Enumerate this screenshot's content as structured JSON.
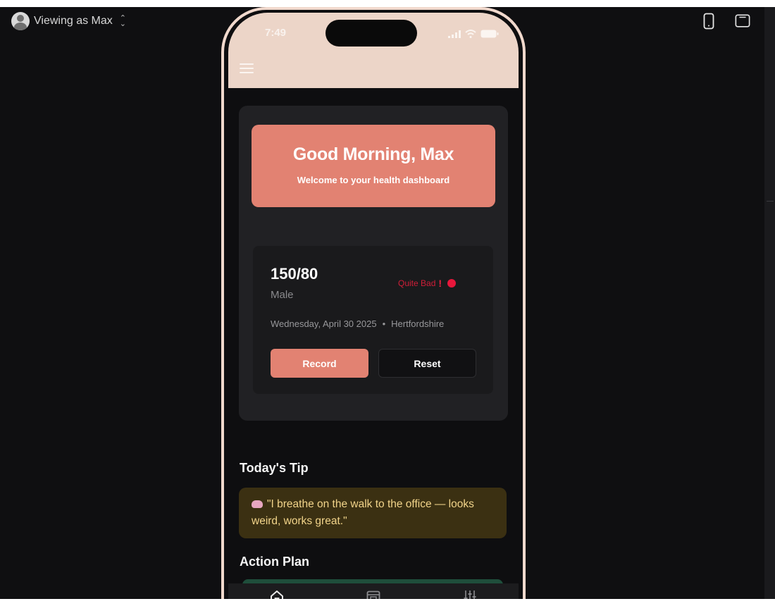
{
  "viewer": {
    "label": "Viewing as Max",
    "avatar_icon": "user-avatar-icon",
    "switch_icon": "chevron-updown-icon"
  },
  "toolbar": {
    "icons": [
      "phone-device-icon",
      "tablet-device-icon"
    ]
  },
  "phone": {
    "status_bar": {
      "time": "7:49",
      "icons": [
        "signal-icon",
        "wifi-icon",
        "battery-icon"
      ]
    },
    "menu_icon": "hamburger-menu-icon",
    "greeting": {
      "title": "Good Morning, Max",
      "subtitle": "Welcome to your health dashboard"
    },
    "reading": {
      "value": "150/80",
      "gender": "Male",
      "status": "Quite Bad",
      "status_mark": "!",
      "date": "Wednesday, April 30 2025",
      "separator": "•",
      "location": "Hertfordshire",
      "record_label": "Record",
      "reset_label": "Reset"
    },
    "tip": {
      "title": "Today's Tip",
      "icon": "brain-icon",
      "text": "\"I breathe on the walk to the office — looks weird, works great.\""
    },
    "action_plan": {
      "title": "Action Plan"
    },
    "bottom_nav": [
      "home-icon",
      "calendar-icon",
      "sliders-icon"
    ]
  },
  "colors": {
    "accent": "#e28272",
    "status_bad": "#e8173b",
    "tip_bg": "#3b3012",
    "tip_text": "#f2d48a",
    "phone_frame": "#f1d9cd"
  }
}
